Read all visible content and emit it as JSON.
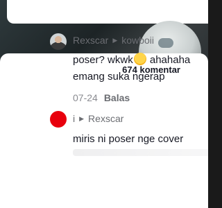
{
  "comments_panel": {
    "count_label": "674 komentar",
    "comments": [
      {
        "author": "Rexscar",
        "reply_to": "kowboii",
        "text_before_emoji": "poser? wkwk",
        "emoji": "rolling-on-floor-laughing",
        "text_after_emoji": " ahahaha",
        "text_line2": "emang suka ngerap",
        "date": "07-24",
        "reply_label": "Balas"
      },
      {
        "author": "i",
        "reply_to": "Rexscar",
        "text": "miris ni poser nge cover"
      }
    ]
  }
}
